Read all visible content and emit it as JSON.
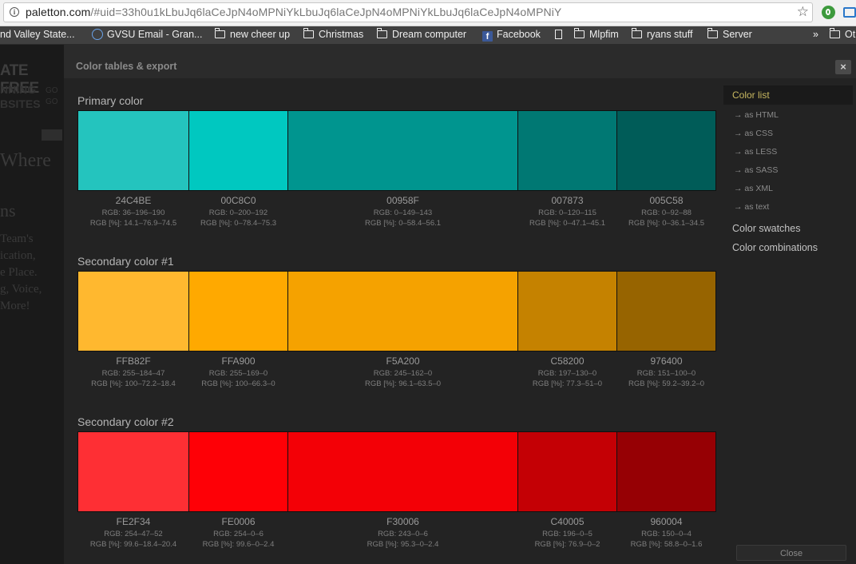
{
  "browser": {
    "url_host": "paletton.com",
    "url_rest": "/#uid=33h0u1kLbuJq6laCeJpN4oMPNiYkLbuJq6laCeJpN4oMPNiYkLbuJq6laCeJpN4oMPNiY",
    "bookmarks": [
      "nd Valley State...",
      "GVSU Email - Gran...",
      "new cheer up",
      "Christmas",
      "Dream computer",
      "Facebook",
      "Mlpfim",
      "ryans stuff",
      "Server",
      "»",
      "Ot"
    ]
  },
  "background": {
    "banner": "ATE FREE",
    "small1": "NNING",
    "small2": "BSITES",
    "go1": "GO",
    "go2": "GO",
    "heading": "Where",
    "sub": "ns",
    "para": "Team's\nication,\ne Place.\ng, Voice,\nMore!"
  },
  "modal": {
    "title": "Color tables & export",
    "close_icon": "×",
    "close_button": "Close"
  },
  "sections": [
    {
      "title": "Primary color",
      "swatches": [
        {
          "hex": "24C4BE",
          "color": "#24C4BE",
          "rgb": "RGB: 36–196–190",
          "rgbp": "RGB [%]: 14.1–76.9–74.5"
        },
        {
          "hex": "00C8C0",
          "color": "#00C8C0",
          "rgb": "RGB: 0–200–192",
          "rgbp": "RGB [%]: 0–78.4–75.3"
        },
        {
          "hex": "00958F",
          "color": "#00958F",
          "rgb": "RGB: 0–149–143",
          "rgbp": "RGB [%]: 0–58.4–56.1"
        },
        {
          "hex": "007873",
          "color": "#007873",
          "rgb": "RGB: 0–120–115",
          "rgbp": "RGB [%]: 0–47.1–45.1"
        },
        {
          "hex": "005C58",
          "color": "#005C58",
          "rgb": "RGB: 0–92–88",
          "rgbp": "RGB [%]: 0–36.1–34.5"
        }
      ]
    },
    {
      "title": "Secondary color #1",
      "swatches": [
        {
          "hex": "FFB82F",
          "color": "#FFB82F",
          "rgb": "RGB: 255–184–47",
          "rgbp": "RGB [%]: 100–72.2–18.4"
        },
        {
          "hex": "FFA900",
          "color": "#FFA900",
          "rgb": "RGB: 255–169–0",
          "rgbp": "RGB [%]: 100–66.3–0"
        },
        {
          "hex": "F5A200",
          "color": "#F5A200",
          "rgb": "RGB: 245–162–0",
          "rgbp": "RGB [%]: 96.1–63.5–0"
        },
        {
          "hex": "C58200",
          "color": "#C58200",
          "rgb": "RGB: 197–130–0",
          "rgbp": "RGB [%]: 77.3–51–0"
        },
        {
          "hex": "976400",
          "color": "#976400",
          "rgb": "RGB: 151–100–0",
          "rgbp": "RGB [%]: 59.2–39.2–0"
        }
      ]
    },
    {
      "title": "Secondary color #2",
      "swatches": [
        {
          "hex": "FE2F34",
          "color": "#FE2F34",
          "rgb": "RGB: 254–47–52",
          "rgbp": "RGB [%]: 99.6–18.4–20.4"
        },
        {
          "hex": "FE0006",
          "color": "#FE0006",
          "rgb": "RGB: 254–0–6",
          "rgbp": "RGB [%]: 99.6–0–2.4"
        },
        {
          "hex": "F30006",
          "color": "#F30006",
          "rgb": "RGB: 243–0–6",
          "rgbp": "RGB [%]: 95.3–0–2.4"
        },
        {
          "hex": "C40005",
          "color": "#C40005",
          "rgb": "RGB: 196–0–5",
          "rgbp": "RGB [%]: 76.9–0–2"
        },
        {
          "hex": "960004",
          "color": "#960004",
          "rgb": "RGB: 150–0–4",
          "rgbp": "RGB [%]: 58.8–0–1.6"
        }
      ]
    }
  ],
  "menu": {
    "color_list": "Color list",
    "exports": [
      "→  as HTML",
      "→  as CSS",
      "→  as LESS",
      "→  as SASS",
      "→  as XML",
      "→  as text"
    ],
    "swatches": "Color swatches",
    "combinations": "Color combinations"
  }
}
